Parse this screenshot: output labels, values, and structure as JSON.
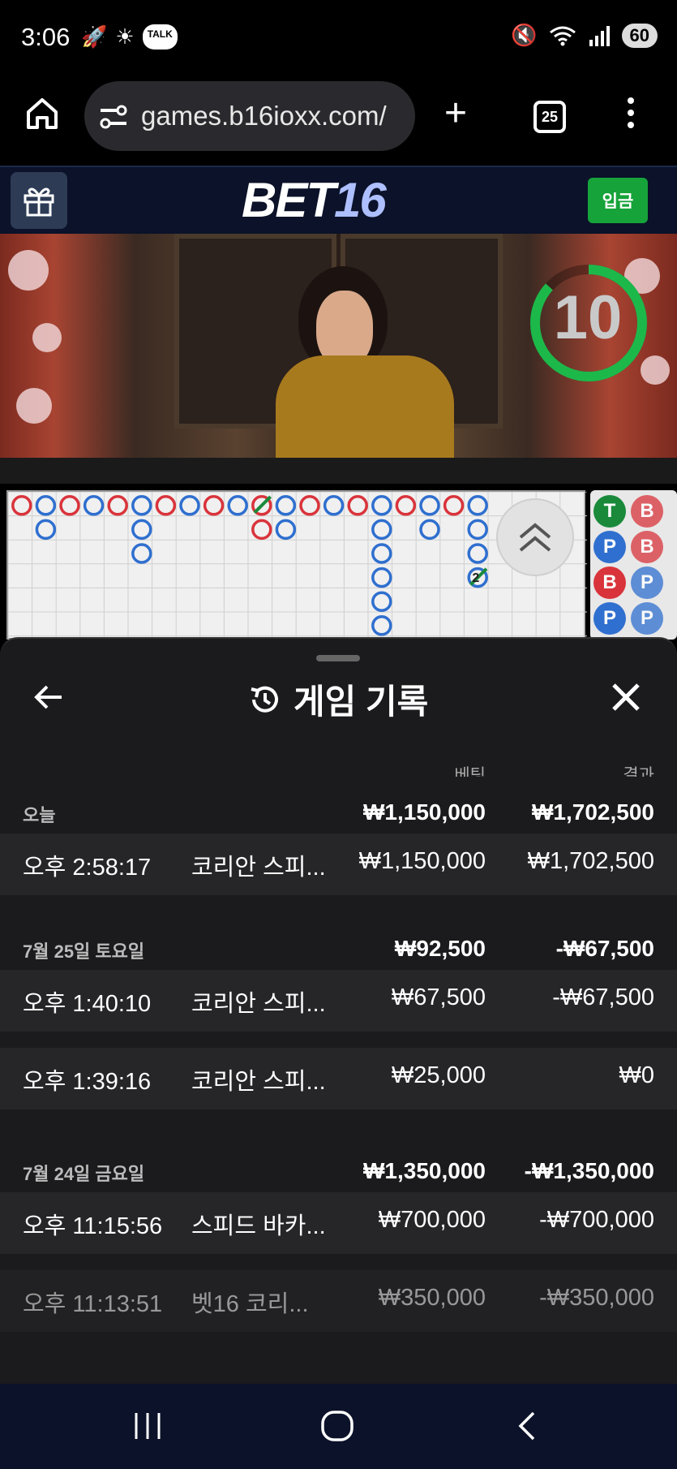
{
  "status_bar": {
    "time": "3:06",
    "battery": "60",
    "talk_label": "TALK"
  },
  "browser": {
    "url": "games.b16ioxx.com/",
    "tab_count": "25"
  },
  "site": {
    "logo_main": "BET",
    "logo_num": "16",
    "deposit_label": "입금"
  },
  "video": {
    "countdown": "10"
  },
  "bead_road": [
    [
      "T",
      "B"
    ],
    [
      "P",
      "B"
    ],
    [
      "B",
      "P"
    ],
    [
      "P",
      "P"
    ]
  ],
  "bigroad": {
    "tie_count": "2"
  },
  "history": {
    "title": "게임 기록",
    "col_bet": "베팅",
    "col_result": "결과",
    "groups": [
      {
        "label": "오늘",
        "bet_total": "₩1,150,000",
        "result_total": "₩1,702,500",
        "rows": [
          {
            "time": "오후 2:58:17",
            "game": "코리안 스피...",
            "bet": "₩1,150,000",
            "result": "₩1,702,500"
          }
        ]
      },
      {
        "label": "7월 25일 토요일",
        "bet_total": "₩92,500",
        "result_total": "-₩67,500",
        "rows": [
          {
            "time": "오후 1:40:10",
            "game": "코리안 스피...",
            "bet": "₩67,500",
            "result": "-₩67,500"
          },
          {
            "time": "오후 1:39:16",
            "game": "코리안 스피...",
            "bet": "₩25,000",
            "result": "₩0"
          }
        ]
      },
      {
        "label": "7월 24일 금요일",
        "bet_total": "₩1,350,000",
        "result_total": "-₩1,350,000",
        "rows": [
          {
            "time": "오후 11:15:56",
            "game": "스피드 바카...",
            "bet": "₩700,000",
            "result": "-₩700,000"
          },
          {
            "time": "오후 11:13:51",
            "game": "벳16 코리...",
            "bet": "₩350,000",
            "result": "-₩350,000"
          }
        ]
      }
    ]
  },
  "colors": {
    "banker": "#d9343b",
    "player": "#2f6fcf",
    "tie": "#1a8a3a",
    "deposit": "#16a33a",
    "nav": "#0b1229"
  }
}
